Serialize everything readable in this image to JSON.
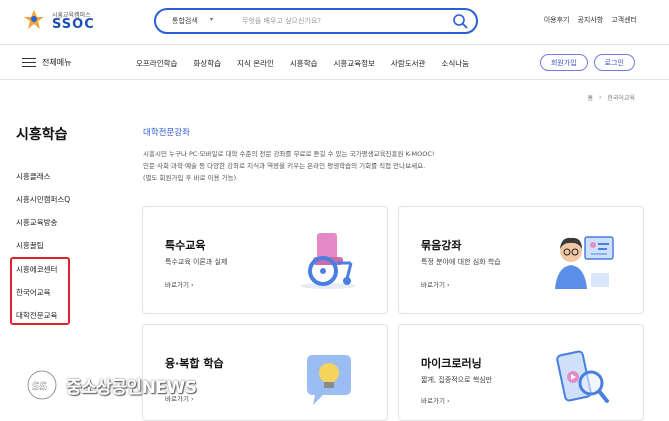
{
  "header": {
    "logo_sub": "시흥교육캠퍼스",
    "logo_main": "SSOC",
    "search_category": "통합검색",
    "search_placeholder": "무엇을 배우고 싶으신가요?",
    "links": [
      "이용후기",
      "공지사항",
      "고객센터"
    ]
  },
  "nav": {
    "menu_label": "전체메뉴",
    "items": [
      "오프라인학습",
      "화상학습",
      "지식 온라인",
      "시흥학습",
      "시흥교육정보",
      "사람도서관",
      "소식나눔"
    ],
    "join_label": "회원가입",
    "login_label": "로그인"
  },
  "breadcrumb": {
    "home": "홈",
    "current": "한국어교육"
  },
  "sidebar": {
    "title": "시흥학습",
    "items": [
      "시흥클래스",
      "시흥시민캠퍼스Q",
      "시흥교육방송",
      "시흥꿀팁",
      "시흥에코센터",
      "한국어교육",
      "대학전문교육"
    ]
  },
  "main": {
    "section_title": "대학전문강좌",
    "description": [
      "시흥시민 누구나 PC·모바일로 대학 수준의 전문 강좌를 무료로 듣길 수 있는 국가평생교육진흥원 K-MOOC!",
      "인문·사회·과학·예술 등 다양한 강좌로 지식과 역량을 키우는 온라인 평생학습의 기회를 직접 만나보세요.",
      "(별도 회원가입 후 바로 이용 가능)"
    ],
    "cards": [
      {
        "title": "특수교육",
        "subtitle": "특수교육 이론과 실제",
        "link": "바로가기 ›",
        "icon": "wheelchair-icon"
      },
      {
        "title": "묶음강좌",
        "subtitle": "특정 분야에 대한 심화 학습",
        "link": "바로가기 ›",
        "icon": "teacher-monitor-icon"
      },
      {
        "title": "융·복합 학습",
        "subtitle": "",
        "link": "바로가기 ›",
        "icon": "lightbulb-icon"
      },
      {
        "title": "마이크로러닝",
        "subtitle": "짧게, 집중적으로 핵심만",
        "link": "바로가기 ›",
        "icon": "phone-magnifier-icon"
      }
    ]
  },
  "watermark": {
    "text": "중소상공인NEWS"
  },
  "colors": {
    "brand_blue": "#2b5fd6",
    "highlight_red": "#d9232e"
  }
}
